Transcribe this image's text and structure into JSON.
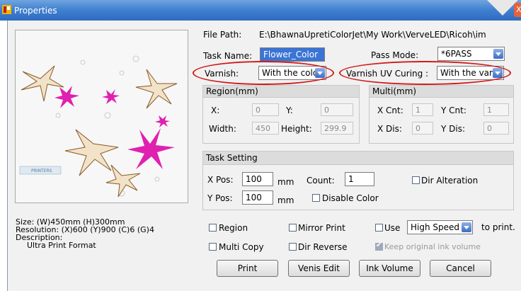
{
  "window": {
    "title": "Properties",
    "close_glyph": "X",
    "accent": "#3f7fcf"
  },
  "preview": {
    "logo_text": "PRINTERS"
  },
  "info": {
    "size": "Size: (W)450mm (H)300mm",
    "resolution": "Resolution: (X)600  (Y)900 (C)6 (G)4",
    "description_label": "Description:",
    "description_value": "Ultra Print Format"
  },
  "file": {
    "label": "File Path:",
    "value": "E:\\BhawnaUpretiColorJet\\My Work\\VerveLED\\Ricoh\\im"
  },
  "task_name": {
    "label": "Task Name:",
    "value": "Flower_Color"
  },
  "pass_mode": {
    "label": "Pass Mode:",
    "value": "*6PASS"
  },
  "varnish": {
    "label": "Varnish:",
    "value": "With the color"
  },
  "varnish_uv": {
    "label": "Varnish UV Curing :",
    "value": "With the varni"
  },
  "region": {
    "title": "Region(mm)",
    "x_label": "X:",
    "x_value": "0",
    "y_label": "Y:",
    "y_value": "0",
    "width_label": "Width:",
    "width_value": "450",
    "height_label": "Height:",
    "height_value": "299.9"
  },
  "multi": {
    "title": "Multi(mm)",
    "xcnt_label": "X Cnt:",
    "xcnt_value": "1",
    "ycnt_label": "Y Cnt:",
    "ycnt_value": "1",
    "xdis_label": "X Dis:",
    "xdis_value": "0",
    "ydis_label": "Y Dis:",
    "ydis_value": "0"
  },
  "task_setting": {
    "title": "Task Setting",
    "xpos_label": "X Pos:",
    "xpos_value": "100",
    "xpos_unit": "mm",
    "ypos_label": "Y Pos:",
    "ypos_value": "100",
    "ypos_unit": "mm",
    "count_label": "Count:",
    "count_value": "1",
    "dir_alteration": "Dir Alteration",
    "disable_color": "Disable Color"
  },
  "options": {
    "region": "Region",
    "mirror_print": "Mirror Print",
    "use": "Use",
    "speed_value": "High Speed",
    "to_print": "to print.",
    "multi_copy": "Multi Copy",
    "dir_reverse": "Dir Reverse",
    "keep_ink": "Keep original ink volume"
  },
  "buttons": {
    "print": "Print",
    "venis_edit": "Venis Edit",
    "ink_volume": "Ink Volume",
    "cancel": "Cancel"
  },
  "annotation_color": "#d31a1a"
}
